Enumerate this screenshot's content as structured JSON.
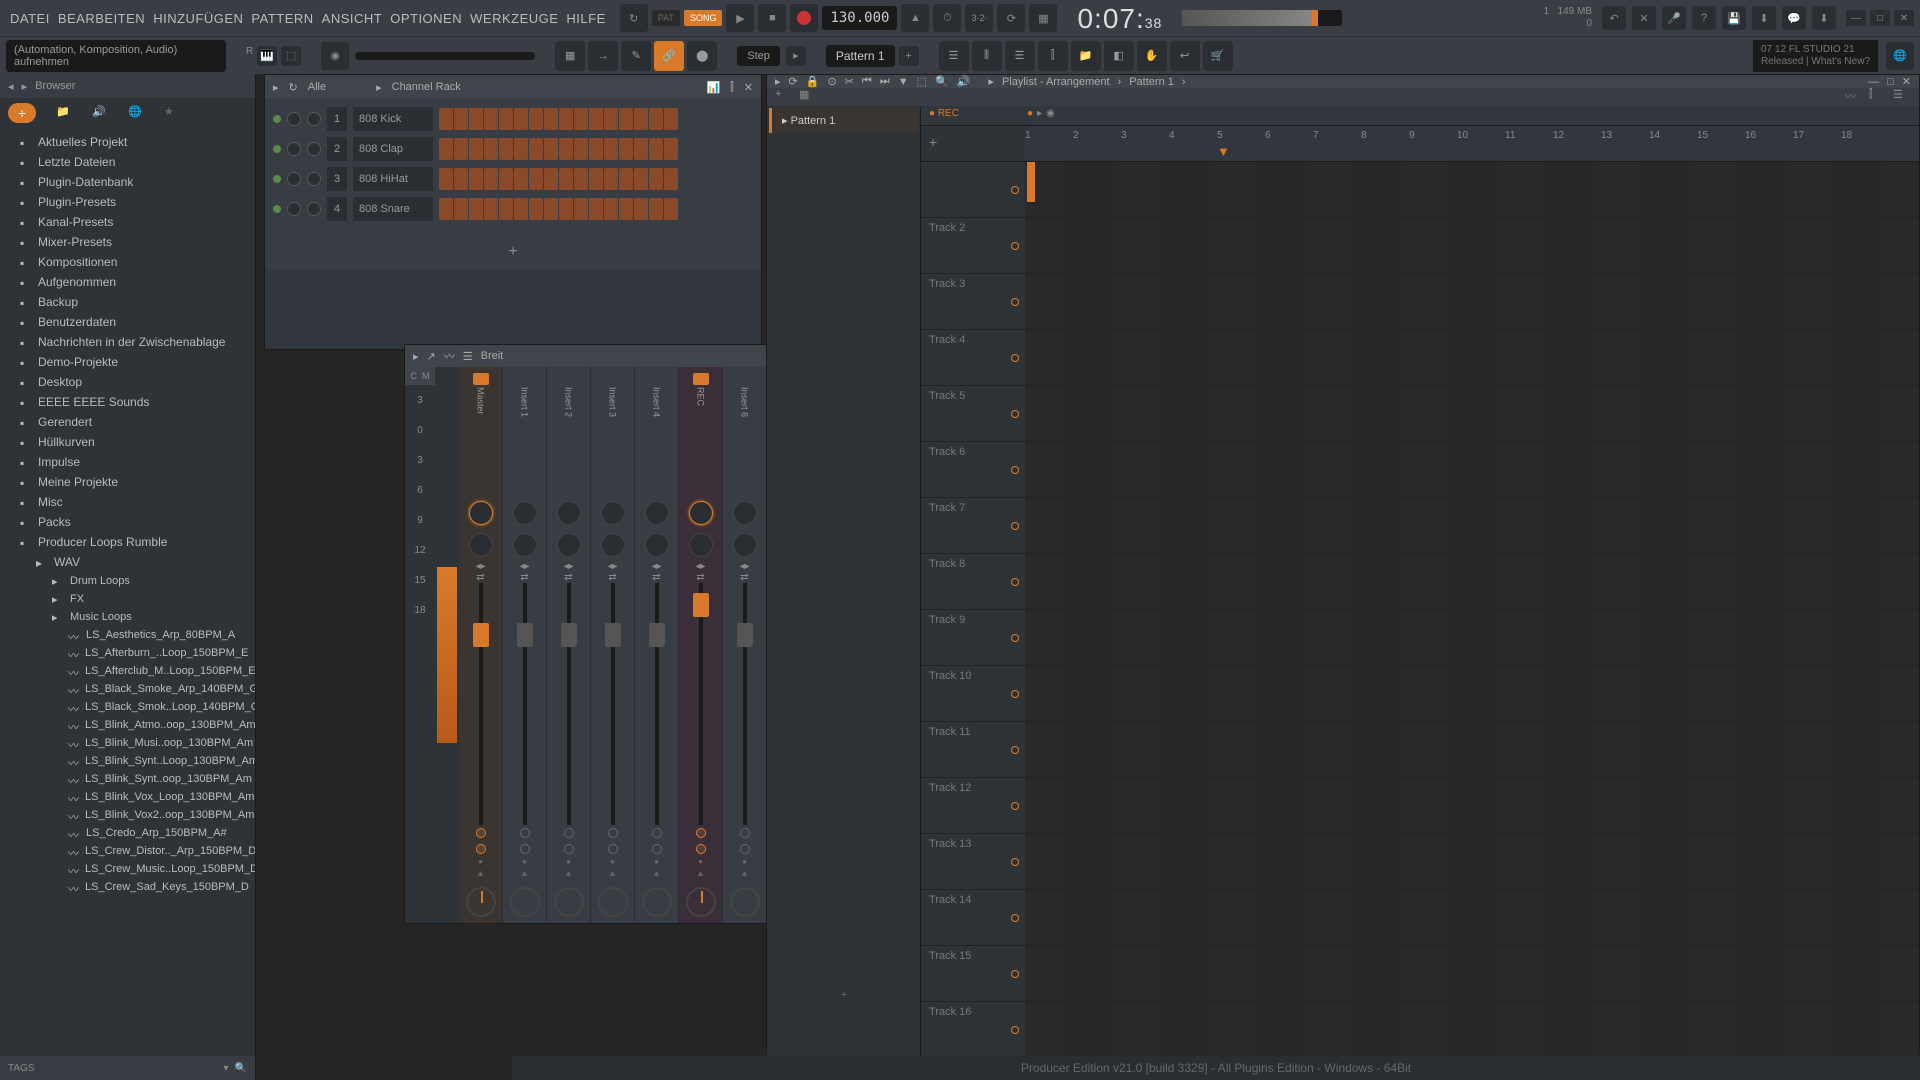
{
  "menu": [
    "DATEI",
    "BEARBEITEN",
    "HINZUFÜGEN",
    "PATTERN",
    "ANSICHT",
    "OPTIONEN",
    "WERKZEUGE",
    "HILFE"
  ],
  "transport": {
    "pat": "PAT",
    "song": "SONG",
    "tempo": "130.000"
  },
  "time": {
    "main": "0:07:",
    "ms": "38"
  },
  "info": {
    "voices": "1",
    "mem": "149 MB",
    "cpu": "0"
  },
  "hint": {
    "title": "(Automation, Komposition, Audio)",
    "sub": "aufnehmen"
  },
  "toolbar": {
    "step": "Step",
    "pattern": "Pattern 1"
  },
  "version": {
    "line1": "07 12  FL STUDIO 21",
    "line2": "Released | What's New?"
  },
  "browser": {
    "title": "Browser",
    "filter": "Alle",
    "items": [
      "Aktuelles Projekt",
      "Letzte Dateien",
      "Plugin-Datenbank",
      "Plugin-Presets",
      "Kanal-Presets",
      "Mixer-Presets",
      "Kompositionen",
      "Aufgenommen",
      "Backup",
      "Benutzerdaten",
      "Nachrichten in der Zwischenablage",
      "Demo-Projekte",
      "Desktop",
      "EEEE EEEE Sounds",
      "Gerendert",
      "Hüllkurven",
      "Impulse",
      "Meine Projekte",
      "Misc",
      "Packs",
      "Producer Loops Rumble"
    ],
    "wav": "WAV",
    "subfolders": [
      "Drum Loops",
      "FX",
      "Music Loops"
    ],
    "files": [
      "LS_Aesthetics_Arp_80BPM_A",
      "LS_Afterburn_..Loop_150BPM_E",
      "LS_Afterclub_M..Loop_150BPM_E",
      "LS_Black_Smoke_Arp_140BPM_G",
      "LS_Black_Smok..Loop_140BPM_G",
      "LS_Blink_Atmo..oop_130BPM_Am",
      "LS_Blink_Musi..oop_130BPM_Am",
      "LS_Blink_Synt..Loop_130BPM_Am",
      "LS_Blink_Synt..oop_130BPM_Am",
      "LS_Blink_Vox_Loop_130BPM_Am",
      "LS_Blink_Vox2..oop_130BPM_Am",
      "LS_Credo_Arp_150BPM_A#",
      "LS_Crew_Distor.._Arp_150BPM_D",
      "LS_Crew_Music..Loop_150BPM_D",
      "LS_Crew_Sad_Keys_150BPM_D"
    ],
    "tags": "TAGS"
  },
  "channelrack": {
    "title": "Channel Rack",
    "filter": "Alle",
    "channels": [
      {
        "num": "1",
        "name": "808 Kick"
      },
      {
        "num": "2",
        "name": "808 Clap"
      },
      {
        "num": "3",
        "name": "808 HiHat"
      },
      {
        "num": "4",
        "name": "808 Snare"
      }
    ]
  },
  "mixer": {
    "title": "Breit",
    "scale": [
      "3",
      "0",
      "3",
      "6",
      "9",
      "12",
      "15",
      "18"
    ],
    "tracks": [
      "Master",
      "Insert 1",
      "Insert 2",
      "Insert 3",
      "Insert 4",
      "REC",
      "Insert 6"
    ]
  },
  "playlist": {
    "title": "Playlist - Arrangement",
    "breadcrumb": "Pattern 1",
    "pattern": "Pattern 1",
    "rec": "● REC",
    "ruler": [
      "1",
      "2",
      "3",
      "4",
      "5",
      "6",
      "7",
      "8",
      "9",
      "10",
      "11",
      "12",
      "13",
      "14",
      "15",
      "16",
      "17",
      "18"
    ],
    "tracks": [
      "",
      "Track 2",
      "Track 3",
      "Track 4",
      "Track 5",
      "Track 6",
      "Track 7",
      "Track 8",
      "Track 9",
      "Track 10",
      "Track 11",
      "Track 12",
      "Track 13",
      "Track 14",
      "Track 15",
      "Track 16"
    ]
  },
  "status": "Producer Edition v21.0 [build 3329] - All Plugins Edition - Windows - 64Bit"
}
